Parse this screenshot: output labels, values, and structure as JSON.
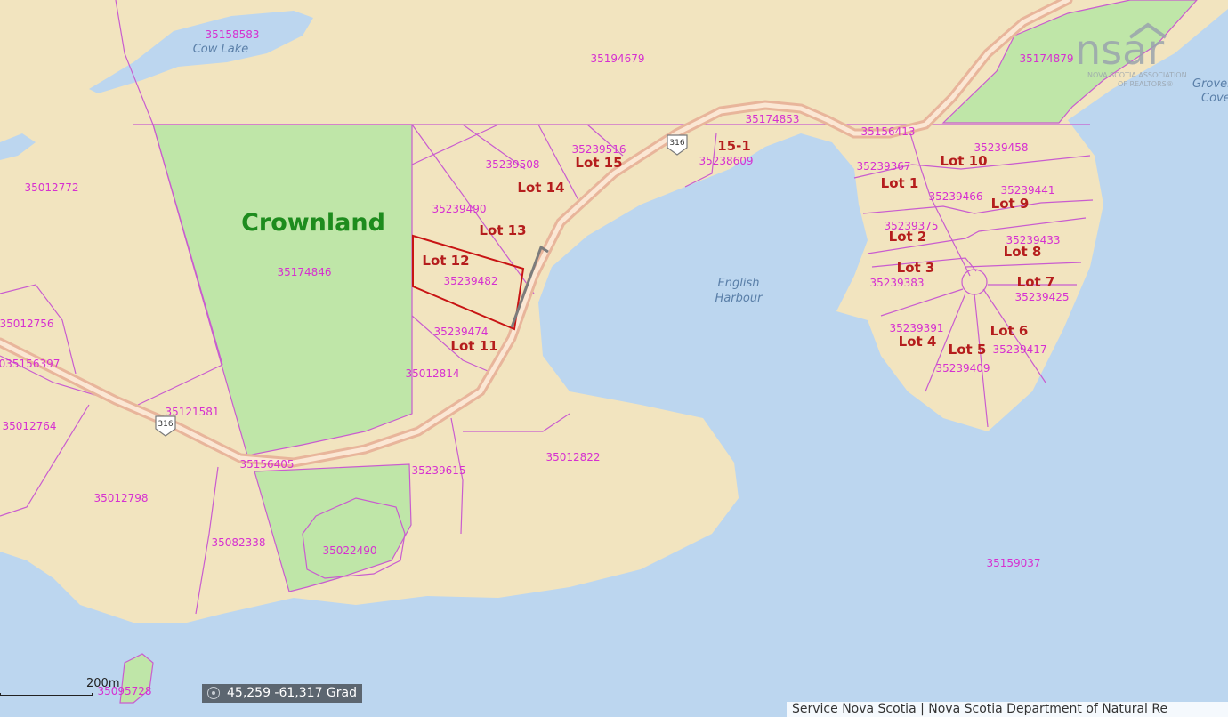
{
  "map": {
    "crownland_label": "Crownland",
    "water_labels": {
      "cow_lake": "Cow Lake",
      "english_harbour_1": "English",
      "english_harbour_2": "Harbour",
      "grove_1": "Grovel",
      "grove_2": "Cove"
    },
    "route_shield": "316",
    "parcels": {
      "p35158583": "35158583",
      "p35194679": "35194679",
      "p35174879": "35174879",
      "p35174853": "35174853",
      "p35156413": "35156413",
      "p35239458": "35239458",
      "p35012772": "35012772",
      "p35174846": "35174846",
      "p35239516": "35239516",
      "p35239508": "35239508",
      "p35239490": "35239490",
      "p35239482": "35239482",
      "p35239474": "35239474",
      "p35012814": "35012814",
      "p35238609": "35238609",
      "p35239367": "35239367",
      "p35239466": "35239466",
      "p35239441": "35239441",
      "p35239375": "35239375",
      "p35239433": "35239433",
      "p35239383": "35239383",
      "p35239425": "35239425",
      "p35239391": "35239391",
      "p35239417": "35239417",
      "p35239409": "35239409",
      "p35012756": "35012756",
      "p35156397": "035156397",
      "p35121581": "35121581",
      "p35012764": "35012764",
      "p35156405": "35156405",
      "p35239615": "35239615",
      "p35012822": "35012822",
      "p35012798": "35012798",
      "p35082338": "35082338",
      "p35022490": "35022490",
      "p35159037": "35159037",
      "p35095728": "35095728"
    },
    "lots": {
      "lot15": "Lot 15",
      "lot14": "Lot 14",
      "lot13": "Lot 13",
      "lot12": "Lot 12",
      "lot11": "Lot 11",
      "lot151": "15-1",
      "lot10": "Lot 10",
      "lot1": "Lot 1",
      "lot9": "Lot 9",
      "lot2": "Lot 2",
      "lot8": "Lot 8",
      "lot3": "Lot 3",
      "lot7": "Lot 7",
      "lot4": "Lot 4",
      "lot6": "Lot 6",
      "lot5": "Lot 5"
    }
  },
  "logo": {
    "main": "nsar",
    "line1": "NOVA SCOTIA ASSOCIATION",
    "line2": "OF REALTORS®"
  },
  "scale": {
    "label": "200m"
  },
  "coordinates": {
    "text": "45,259 -61,317 Grad"
  },
  "attribution": {
    "text": "Service Nova Scotia | Nova Scotia Department of Natural Re"
  },
  "colors": {
    "water": "#bcd6ef",
    "land": "#f2e4bf",
    "crownland": "#bfe6a8",
    "parcel_line": "#c95ccf",
    "selected_lot": "#c81414",
    "parcel_id": "#d630d0",
    "lot_label": "#b51d1d"
  }
}
